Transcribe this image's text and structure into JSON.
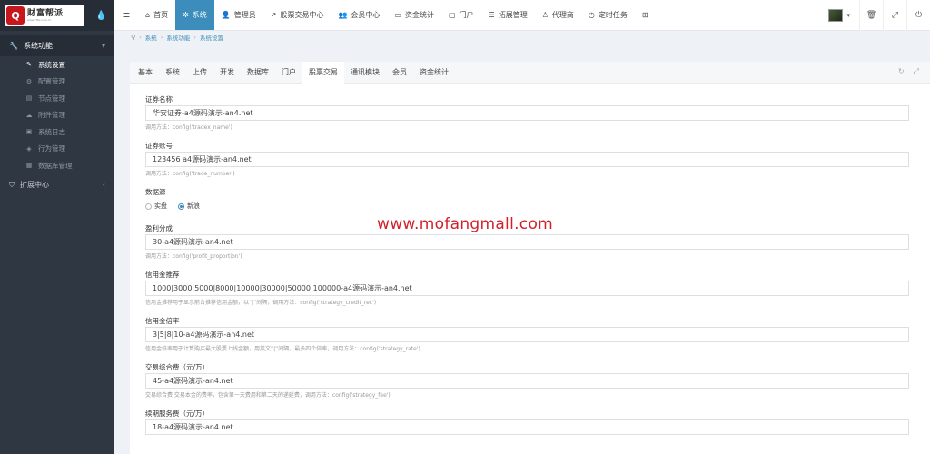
{
  "logo": {
    "text": "财富帮派",
    "sub": "www.cfbp.com.cn"
  },
  "sidebar": {
    "groups": [
      {
        "label": "系统功能",
        "items": [
          {
            "label": "系统设置",
            "icon": "wrench-icon"
          },
          {
            "label": "配置管理",
            "icon": "cogs-icon"
          },
          {
            "label": "节点管理",
            "icon": "sitemap-icon"
          },
          {
            "label": "附件管理",
            "icon": "cloud-icon"
          },
          {
            "label": "系统日志",
            "icon": "log-icon"
          },
          {
            "label": "行为管理",
            "icon": "action-icon"
          },
          {
            "label": "数据库管理",
            "icon": "database-icon"
          }
        ]
      },
      {
        "label": "扩展中心"
      }
    ]
  },
  "topnav": {
    "items": [
      {
        "label": "首页",
        "icon": "home-icon"
      },
      {
        "label": "系统",
        "icon": "gear-icon"
      },
      {
        "label": "管理员",
        "icon": "user-icon"
      },
      {
        "label": "股票交易中心",
        "icon": "chart-icon"
      },
      {
        "label": "会员中心",
        "icon": "users-icon"
      },
      {
        "label": "资金统计",
        "icon": "money-icon"
      },
      {
        "label": "门户",
        "icon": "portal-icon"
      },
      {
        "label": "拓展管理",
        "icon": "list-icon"
      },
      {
        "label": "代理商",
        "icon": "person-icon"
      },
      {
        "label": "定时任务",
        "icon": "clock-icon"
      }
    ]
  },
  "breadcrumb": [
    "系统",
    "系统功能",
    "系统设置"
  ],
  "tabs": [
    "基本",
    "系统",
    "上传",
    "开发",
    "数据库",
    "门户",
    "股票交易",
    "通讯模块",
    "会员",
    "资金统计"
  ],
  "form": {
    "fields": [
      {
        "label": "证券名称",
        "value": "华安证券-a4源码演示-an4.net",
        "help": "调用方法：config('tradex_name')"
      },
      {
        "label": "证券账号",
        "value": "123456  a4源码演示-an4.net",
        "help": "调用方法：config('trade_number')"
      },
      {
        "label": "盈利分成",
        "value": "30-a4源码演示-an4.net",
        "help": "调用方法：config('profit_proportion')"
      },
      {
        "label": "信用金推荐",
        "value": "1000|3000|5000|8000|10000|30000|50000|100000-a4源码演示-an4.net",
        "help": "信用金推荐用于显示前台推荐信用金额，以“|”间隔，调用方法：config('strategy_credit_rec')"
      },
      {
        "label": "信用金倍率",
        "value": "3|5|8|10-a4源码演示-an4.net",
        "help": "信用金倍率用于计算购买最大股票上线金额，用英文“|”间隔，最多四个倍率，调用方法：config('strategy_rate')"
      },
      {
        "label": "交易综合费（元/万）",
        "value": "45-a4源码演示-an4.net",
        "help": "交易综合费 交易本金的费率，包含第一天费用和第二天的递延费，调用方法：config('strategy_fee')"
      },
      {
        "label": "续期服务费（元/万）",
        "value": "18-a4源码演示-an4.net",
        "help": ""
      }
    ],
    "datasource": {
      "label": "数据源",
      "options": [
        "实盘",
        "新浪"
      ],
      "selected": "新浪"
    }
  },
  "watermark": "www.mofangmall.com",
  "colors": {
    "sidebar": "#2f3742",
    "accent": "#3c8dbc",
    "watermark": "#d21f2b"
  }
}
